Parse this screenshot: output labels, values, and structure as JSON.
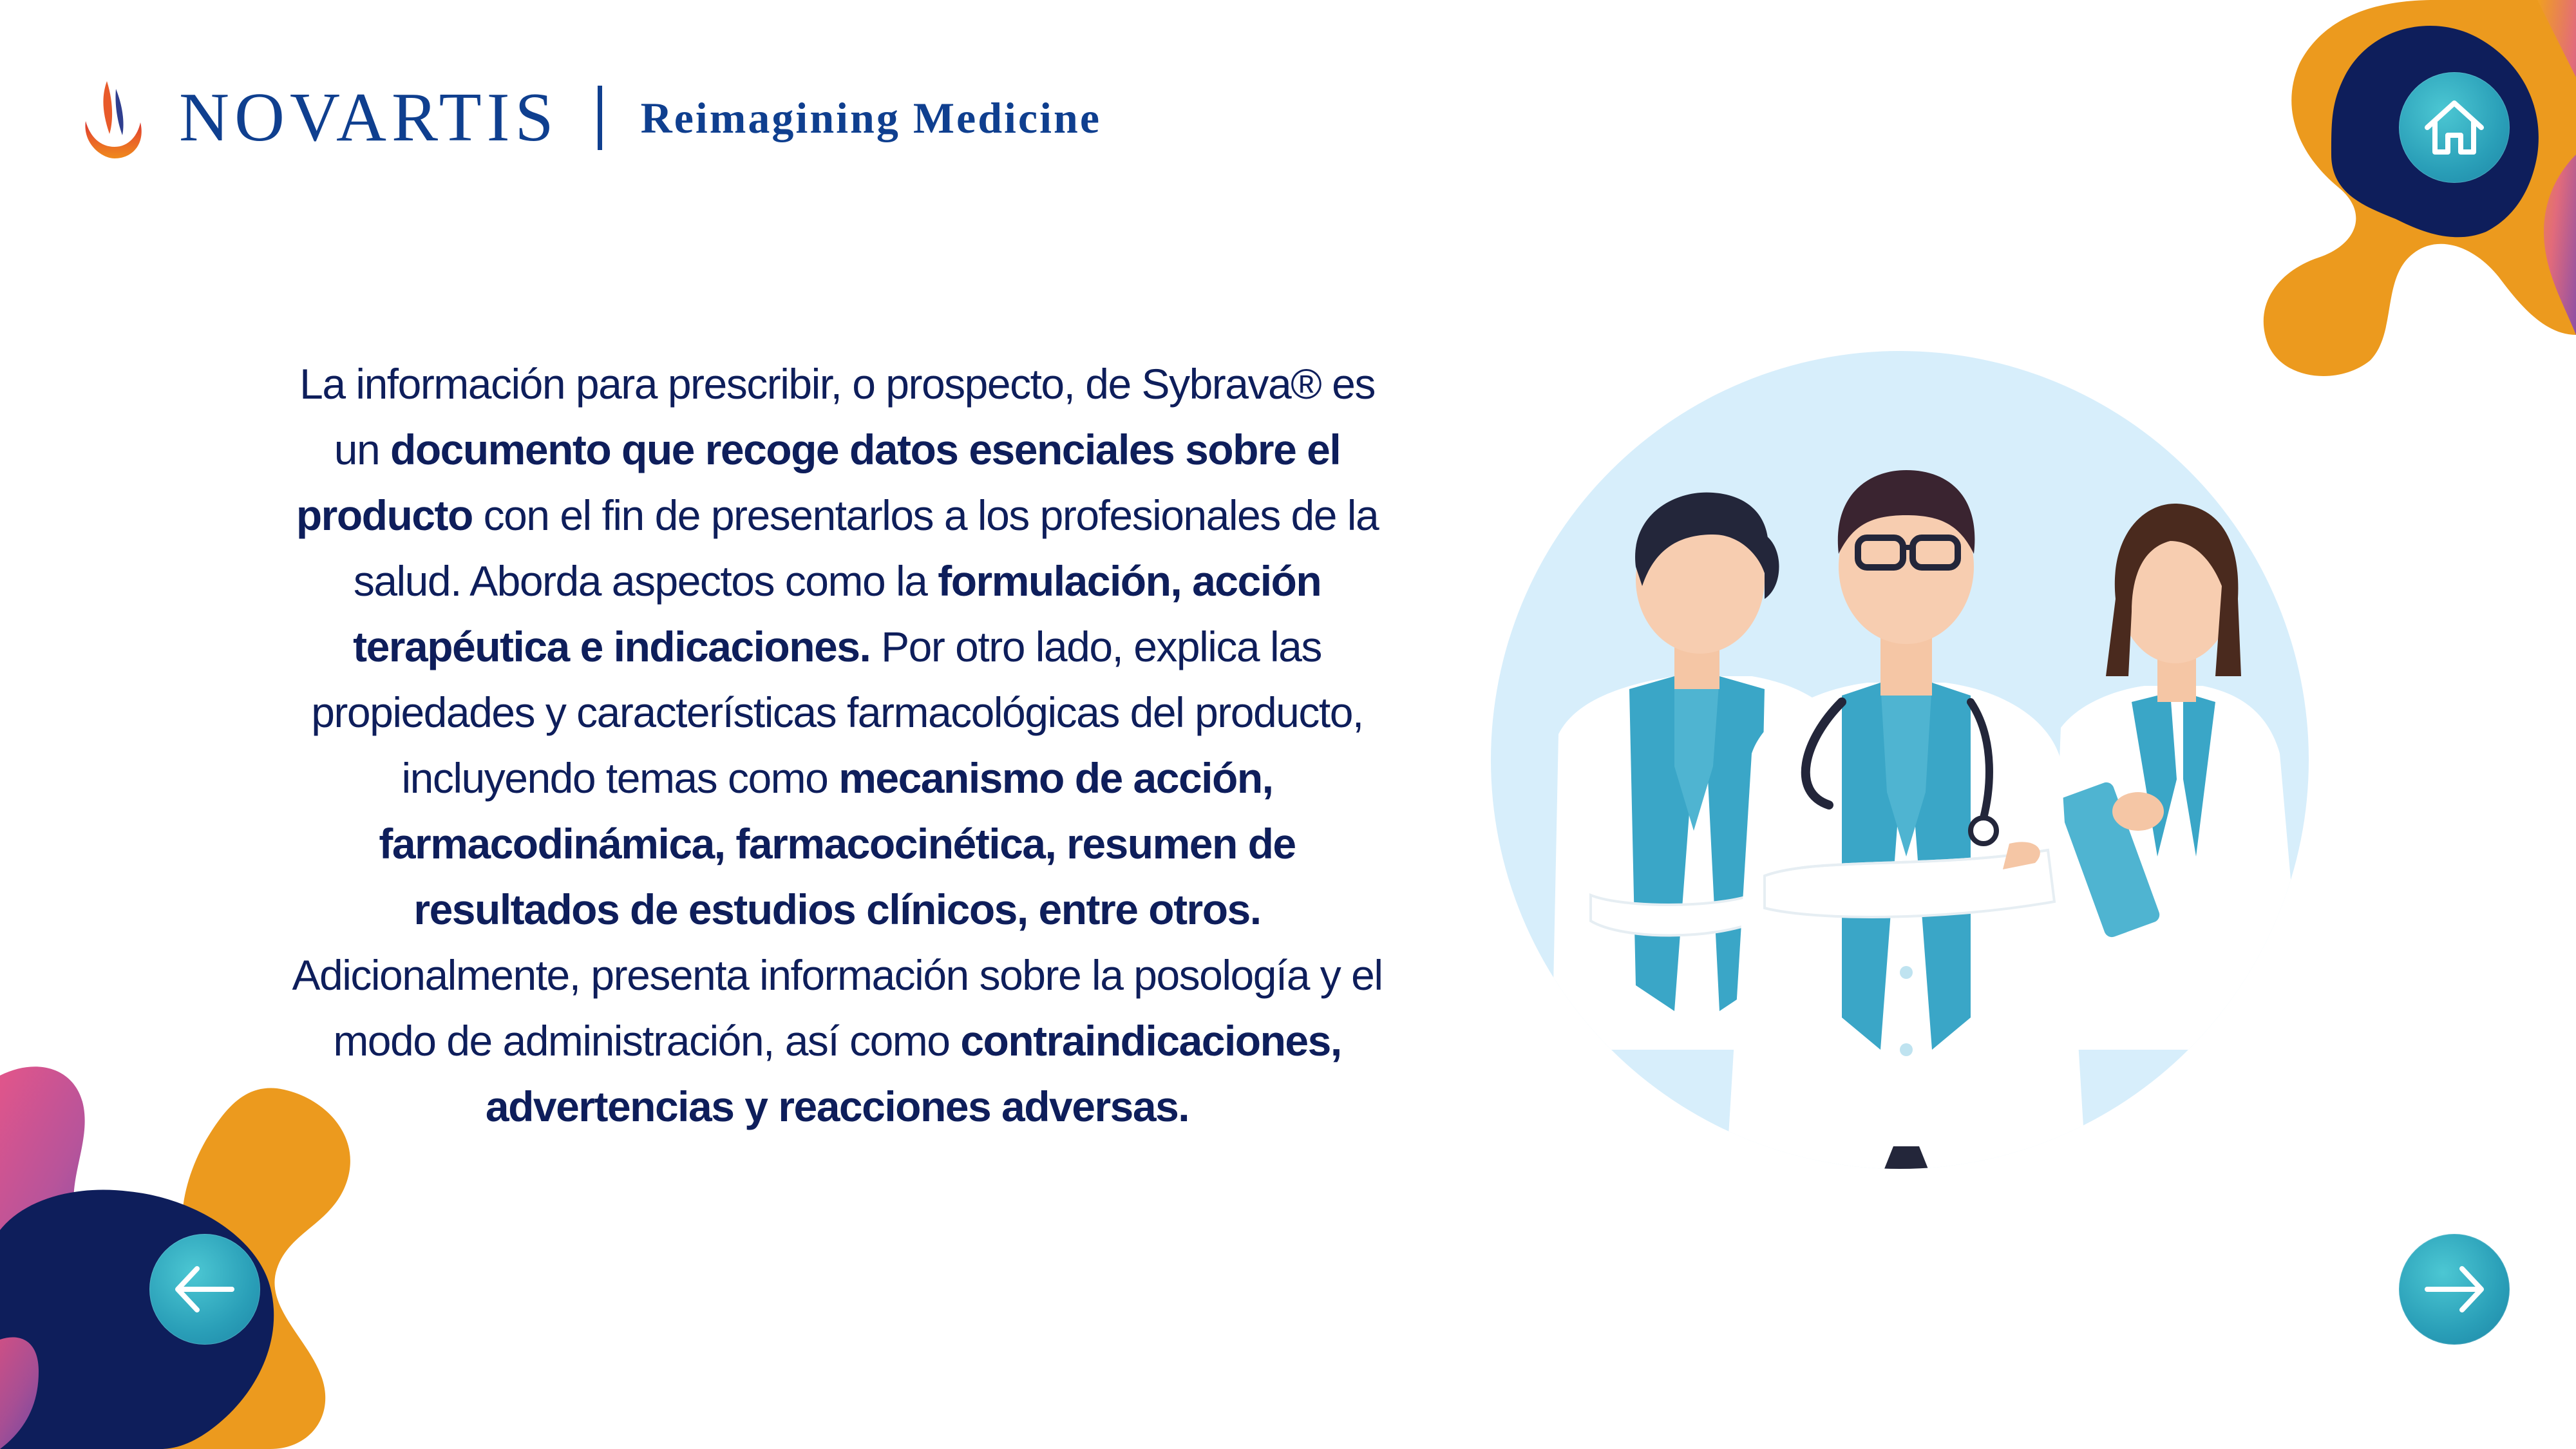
{
  "header": {
    "brand_name": "NOVARTIS",
    "tagline": "Reimagining Medicine"
  },
  "body": {
    "segments": [
      {
        "text": "La información para prescribir, o prospecto, de Sybrava® es un ",
        "bold": false
      },
      {
        "text": "documento que recoge datos esenciales sobre el producto",
        "bold": true
      },
      {
        "text": " con el fin de presentarlos a los profesionales de la salud. Aborda aspectos como la ",
        "bold": false
      },
      {
        "text": "formulación, acción terapéutica e indicaciones.",
        "bold": true
      },
      {
        "text": " Por otro lado, explica las propiedades y características farmacológicas del producto, incluyendo temas como ",
        "bold": false
      },
      {
        "text": "mecanismo de acción, farmacodinámica, farmacocinética, resumen de resultados de estudios clínicos, entre otros.",
        "bold": true
      },
      {
        "text": " Adicionalmente, presenta información sobre la posología y el modo de administración, así como ",
        "bold": false
      },
      {
        "text": "contraindicaciones, advertencias y reacciones adversas.",
        "bold": true
      }
    ]
  },
  "navigation": {
    "home_icon": "home-icon",
    "prev_icon": "arrow-left-icon",
    "next_icon": "arrow-right-icon"
  },
  "colors": {
    "navy": "#0e1e5b",
    "brand_blue": "#0f3f8f",
    "orange": "#ec9a1e",
    "magenta": "#e2558a",
    "purple": "#8e4fa6",
    "teal": "#2a9fb8",
    "light_blue": "#d7eefb"
  }
}
